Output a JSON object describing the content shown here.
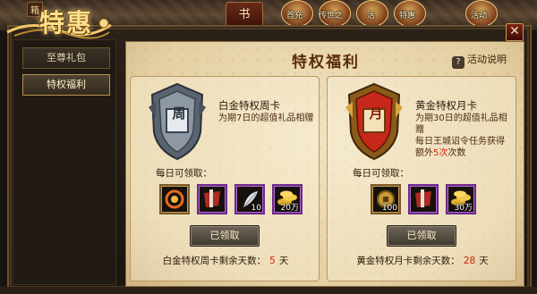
{
  "logo": {
    "tag": "箱",
    "text": "特惠"
  },
  "topbar": {
    "book_label": "书",
    "icons": [
      {
        "label": "首充"
      },
      {
        "label": "传世之"
      },
      {
        "label": "活"
      },
      {
        "label": "特惠"
      },
      {
        "label": "活动"
      }
    ]
  },
  "close_label": "✕",
  "nav": {
    "items": [
      {
        "label": "至尊礼包"
      },
      {
        "label": "特权福利"
      }
    ],
    "active_index": 1
  },
  "content": {
    "title": "特权福利",
    "help_label": "活动说明",
    "help_icon": "?"
  },
  "cards": [
    {
      "name": "白金特权周卡",
      "emblem_char": "周",
      "desc": "为期7日的超值礼品相赠",
      "daily_label": "每日可领取：",
      "items": [
        {
          "icon": "fire-ring-icon",
          "count": ""
        },
        {
          "icon": "gem-bag-icon",
          "count": ""
        },
        {
          "icon": "feather-icon",
          "count": "10"
        },
        {
          "icon": "gold-coins-icon",
          "count": "20万"
        }
      ],
      "claim_label": "已领取",
      "footer_prefix": "白金特权周卡剩余天数：",
      "footer_num": "5",
      "footer_suffix": "天"
    },
    {
      "name": "黄金特权月卡",
      "emblem_char": "月",
      "desc_line1": "为期30日的超值礼品相赠",
      "desc_line2_pre": "每日王城诏令任务获得额外",
      "desc_line2_hl": "5次",
      "desc_line2_post": "次数",
      "daily_label": "每日可领取：",
      "items": [
        {
          "icon": "coin-icon",
          "count": "100"
        },
        {
          "icon": "gem-bag-icon",
          "count": ""
        },
        {
          "icon": "gold-coins-icon",
          "count": "30万"
        }
      ],
      "claim_label": "已领取",
      "footer_prefix": "黄金特权月卡剩余天数：",
      "footer_num": "28",
      "footer_suffix": "天"
    }
  ],
  "colors": {
    "accent_red": "#d8200a",
    "parchment": "#f1e3c2",
    "frame": "#6a5232"
  }
}
